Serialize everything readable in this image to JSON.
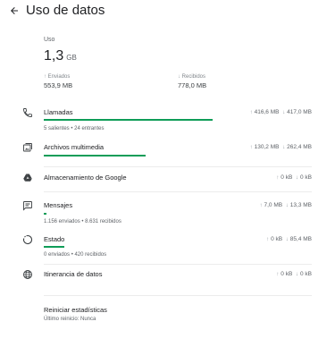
{
  "header": {
    "title": "Uso de datos",
    "back_icon": "arrow-back-icon"
  },
  "summary": {
    "label": "Uso",
    "total_value": "1,3",
    "total_unit": "GB",
    "sent_label": "Enviados",
    "sent_value": "553,9 MB",
    "received_label": "Recibidos",
    "received_value": "778,0 MB"
  },
  "accent_color": "#0f9d58",
  "items": [
    {
      "icon": "phone-icon",
      "name": "Llamadas",
      "sent": "416,6 MB",
      "received": "417,0 MB",
      "usage_fraction": 0.9,
      "sub": "5 salientes • 24 entrantes"
    },
    {
      "icon": "media-icon",
      "name": "Archivos multimedia",
      "sent": "130,2 MB",
      "received": "262,4 MB",
      "usage_fraction": 0.49,
      "sub": ""
    },
    {
      "icon": "google-drive-icon",
      "name": "Almacenamiento de Google",
      "sent": "0 kB",
      "received": "0 kB",
      "usage_fraction": 0,
      "sub": ""
    },
    {
      "icon": "message-icon",
      "name": "Mensajes",
      "sent": "7,0 MB",
      "received": "13,3 MB",
      "usage_fraction": 0.012,
      "sub": "1.156 enviados • 8.631 recibidos"
    },
    {
      "icon": "status-icon",
      "name": "Estado",
      "sent": "0 kB",
      "received": "85,4 MB",
      "usage_fraction": 0.1,
      "sub": "0 enviados • 420 recibidos"
    },
    {
      "icon": "globe-icon",
      "name": "Itinerancia de datos",
      "sent": "0 kB",
      "received": "0 kB",
      "usage_fraction": 0,
      "sub": ""
    }
  ],
  "reset": {
    "title": "Reiniciar estadísticas",
    "subtitle": "Último reinicio: Nunca"
  }
}
